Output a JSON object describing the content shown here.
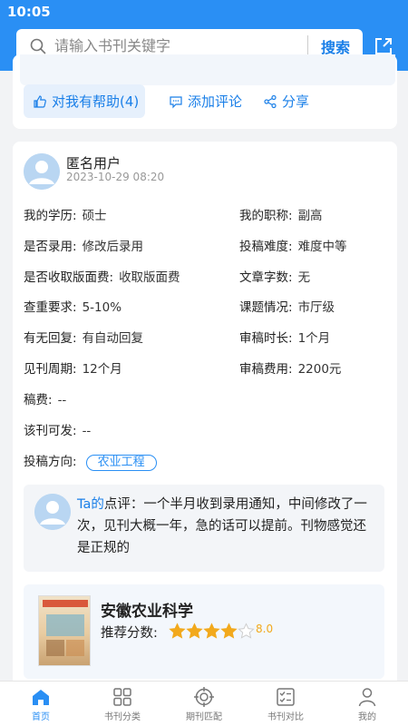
{
  "status_bar": {
    "time": "10:05"
  },
  "search": {
    "placeholder": "请输入书刊关键字",
    "button_label": "搜索"
  },
  "actions": {
    "helpful_label": "对我有帮助(4)",
    "comment_label": "添加评论",
    "share_label": "分享"
  },
  "review": {
    "user_name": "匿名用户",
    "time": "2023-10-29 08:20",
    "fields_left": [
      {
        "label": "我的学历:",
        "value": "硕士"
      },
      {
        "label": "是否录用:",
        "value": "修改后录用"
      },
      {
        "label": "是否收取版面费:",
        "value": "收取版面费"
      },
      {
        "label": "查重要求:",
        "value": "5-10%"
      },
      {
        "label": "有无回复:",
        "value": "有自动回复"
      },
      {
        "label": "见刊周期:",
        "value": "12个月"
      },
      {
        "label": "稿费:",
        "value": "--"
      },
      {
        "label": "该刊可发:",
        "value": "--"
      }
    ],
    "fields_right": [
      {
        "label": "我的职称:",
        "value": "副高"
      },
      {
        "label": "投稿难度:",
        "value": "难度中等"
      },
      {
        "label": "文章字数:",
        "value": "无"
      },
      {
        "label": "课题情况:",
        "value": "市厅级"
      },
      {
        "label": "审稿时长:",
        "value": "1个月"
      },
      {
        "label": "审稿费用:",
        "value": "2200元"
      }
    ],
    "direction_label": "投稿方向:",
    "direction_tag": "农业工程",
    "comment_prefix_ta": "Ta的",
    "comment_prefix_rest": "点评：",
    "comment_text": "一个半月收到录用通知，中间修改了一次，见刊大概一年，急的话可以提前。刊物感觉还是正规的"
  },
  "journal": {
    "title": "安徽农业科学",
    "rating_label": "推荐分数:",
    "score": "8.0",
    "stars_filled": 4,
    "stars_total": 5
  },
  "tabs": [
    {
      "label": "首页",
      "icon": "home-icon",
      "active": true
    },
    {
      "label": "书刊分类",
      "icon": "grid-icon",
      "active": false
    },
    {
      "label": "期刊匹配",
      "icon": "target-icon",
      "active": false
    },
    {
      "label": "书刊对比",
      "icon": "checklist-icon",
      "active": false
    },
    {
      "label": "我的",
      "icon": "user-icon",
      "active": false
    }
  ],
  "colors": {
    "brand": "#2a8ff4",
    "star": "#f2a91c"
  }
}
